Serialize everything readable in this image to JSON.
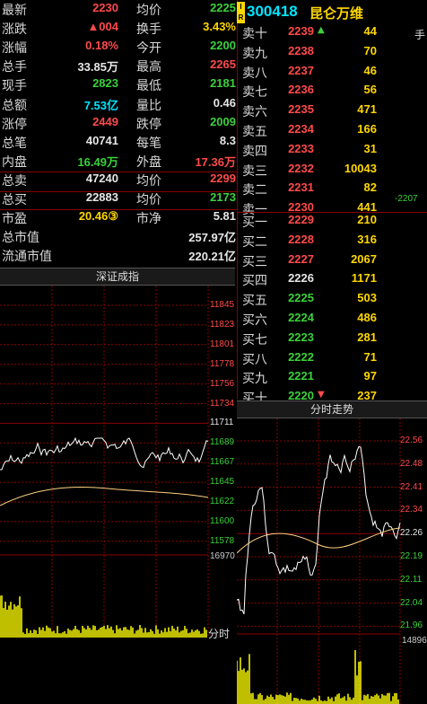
{
  "header": {
    "code": "300418",
    "name": "昆仑万维",
    "badge_top": "I",
    "badge_bottom": "R",
    "extra_right": "手"
  },
  "quote": {
    "left": [
      {
        "label": "最新",
        "value": "2230",
        "color": "red"
      },
      {
        "label": "涨跌",
        "value": "▲004",
        "color": "red"
      },
      {
        "label": "涨幅",
        "value": "0.18%",
        "color": "red"
      },
      {
        "label": "总手",
        "value": "33.85万",
        "color": "white"
      },
      {
        "label": "现手",
        "value": "2823",
        "color": "green"
      },
      {
        "label": "总额",
        "value": "7.53亿",
        "color": "cyan"
      },
      {
        "label": "涨停",
        "value": "2449",
        "color": "red"
      },
      {
        "label": "总笔",
        "value": "40741",
        "color": "white"
      },
      {
        "label": "内盘",
        "value": "16.49万",
        "color": "green"
      },
      {
        "label": "总卖",
        "value": "47240",
        "color": "white"
      },
      {
        "label": "总买",
        "value": "22883",
        "color": "white"
      },
      {
        "label": "市盈",
        "value": "20.46③",
        "color": "yellow"
      },
      {
        "label": "总市值",
        "value": "",
        "color": "white"
      },
      {
        "label": "流通市值",
        "value": "",
        "color": "white"
      }
    ],
    "right": [
      {
        "label": "均价",
        "value": "2225",
        "color": "green"
      },
      {
        "label": "换手",
        "value": "3.43%",
        "color": "yellow"
      },
      {
        "label": "今开",
        "value": "2200",
        "color": "green"
      },
      {
        "label": "最高",
        "value": "2265",
        "color": "red"
      },
      {
        "label": "最低",
        "value": "2181",
        "color": "green"
      },
      {
        "label": "量比",
        "value": "0.46",
        "color": "white"
      },
      {
        "label": "跌停",
        "value": "2009",
        "color": "green"
      },
      {
        "label": "每笔",
        "value": "8.3",
        "color": "white"
      },
      {
        "label": "外盘",
        "value": "17.36万",
        "color": "red"
      },
      {
        "label": "均价",
        "value": "2299",
        "color": "red"
      },
      {
        "label": "均价",
        "value": "2173",
        "color": "green"
      },
      {
        "label": "市净",
        "value": "5.81",
        "color": "white"
      },
      {
        "label": "",
        "value": "257.97亿",
        "color": "white"
      },
      {
        "label": "",
        "value": "220.21亿",
        "color": "white"
      }
    ]
  },
  "orderbook": {
    "asks": [
      {
        "label": "卖十",
        "price": "2239",
        "vol": "44",
        "color": "red",
        "mark": "▲"
      },
      {
        "label": "卖九",
        "price": "2238",
        "vol": "70",
        "color": "red",
        "mark": ""
      },
      {
        "label": "卖八",
        "price": "2237",
        "vol": "46",
        "color": "red",
        "mark": ""
      },
      {
        "label": "卖七",
        "price": "2236",
        "vol": "56",
        "color": "red",
        "mark": ""
      },
      {
        "label": "卖六",
        "price": "2235",
        "vol": "471",
        "color": "red",
        "mark": ""
      },
      {
        "label": "卖五",
        "price": "2234",
        "vol": "166",
        "color": "red",
        "mark": ""
      },
      {
        "label": "卖四",
        "price": "2233",
        "vol": "31",
        "color": "red",
        "mark": ""
      },
      {
        "label": "卖三",
        "price": "2232",
        "vol": "10043",
        "color": "red",
        "mark": ""
      },
      {
        "label": "卖二",
        "price": "2231",
        "vol": "82",
        "color": "red",
        "mark": ""
      },
      {
        "label": "卖一",
        "price": "2230",
        "vol": "441",
        "color": "red",
        "mark": ""
      }
    ],
    "bids": [
      {
        "label": "买一",
        "price": "2229",
        "vol": "210",
        "color": "red",
        "mark": ""
      },
      {
        "label": "买二",
        "price": "2228",
        "vol": "316",
        "color": "red",
        "mark": ""
      },
      {
        "label": "买三",
        "price": "2227",
        "vol": "2067",
        "color": "red",
        "mark": ""
      },
      {
        "label": "买四",
        "price": "2226",
        "vol": "1171",
        "color": "white",
        "mark": ""
      },
      {
        "label": "买五",
        "price": "2225",
        "vol": "503",
        "color": "green",
        "mark": ""
      },
      {
        "label": "买六",
        "price": "2224",
        "vol": "486",
        "color": "green",
        "mark": ""
      },
      {
        "label": "买七",
        "price": "2223",
        "vol": "281",
        "color": "green",
        "mark": ""
      },
      {
        "label": "买八",
        "price": "2222",
        "vol": "71",
        "color": "green",
        "mark": ""
      },
      {
        "label": "买九",
        "price": "2221",
        "vol": "97",
        "color": "green",
        "mark": ""
      },
      {
        "label": "买十",
        "price": "2220",
        "vol": "237",
        "color": "green",
        "mark": "▼"
      }
    ],
    "side_note": "-2207"
  },
  "index_panel": {
    "title": "深证成指",
    "axis": [
      "11845",
      "11823",
      "11801",
      "11778",
      "11756",
      "11734",
      "11711",
      "11689",
      "11667",
      "11645",
      "11622",
      "11600",
      "11578"
    ],
    "vol_label": "16970",
    "time_label": "分时"
  },
  "intraday_panel": {
    "title": "分时走势",
    "axis": [
      "22.56",
      "22.48",
      "22.41",
      "22.34",
      "22.26",
      "22.19",
      "22.11",
      "22.04",
      "21.96"
    ],
    "vol_label": "14896",
    "time_label": "分时"
  },
  "colors": {
    "up": "#ff4a4a",
    "down": "#3bd13b",
    "grid": "#8b0000",
    "price_line": "#ffffff",
    "avg_line": "#ffd080",
    "volume": "#ffff00"
  }
}
